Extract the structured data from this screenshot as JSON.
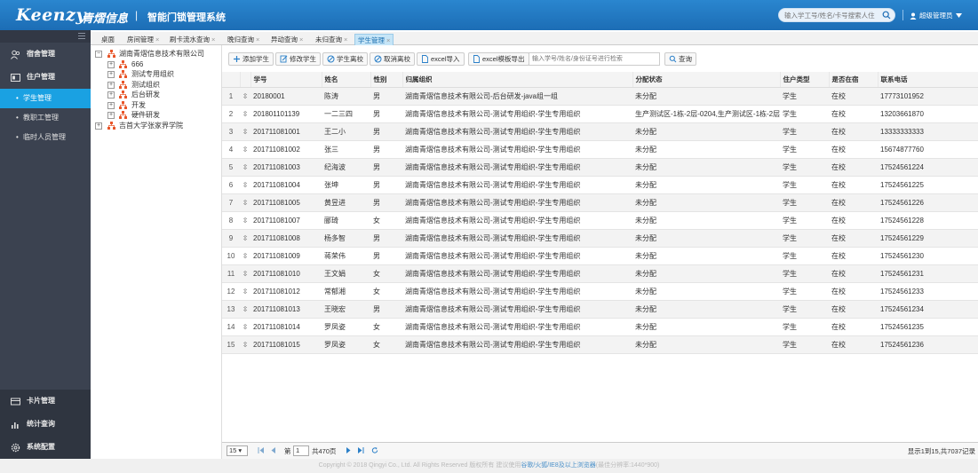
{
  "header": {
    "logo": "Keenzy",
    "logo_cn": "青熠信息",
    "separator": "|",
    "system_title": "智能门锁管理系统",
    "search_placeholder": "输入学工号/姓名/卡号搜索人住",
    "user_label": "超级管理员",
    "user_icon": "user-icon",
    "dropdown_icon": "caret-down-icon"
  },
  "sidebar": {
    "menus": [
      {
        "label": "宿舍管理",
        "icon": "dorm-icon"
      },
      {
        "label": "住户管理",
        "icon": "resident-icon"
      }
    ],
    "sub_items": [
      {
        "label": "学生管理",
        "active": true
      },
      {
        "label": "教职工管理",
        "active": false
      },
      {
        "label": "临时人员管理",
        "active": false
      }
    ],
    "bottom_menus": [
      {
        "label": "卡片管理",
        "icon": "card-icon"
      },
      {
        "label": "统计查询",
        "icon": "chart-icon"
      },
      {
        "label": "系统配置",
        "icon": "gear-icon"
      }
    ]
  },
  "tabs": [
    {
      "label": "桌面",
      "closable": false,
      "active": false
    },
    {
      "label": "房间管理",
      "closable": true,
      "active": false
    },
    {
      "label": "刷卡流水查询",
      "closable": true,
      "active": false
    },
    {
      "label": "晚归查询",
      "closable": true,
      "active": false
    },
    {
      "label": "异动查询",
      "closable": true,
      "active": false
    },
    {
      "label": "未归查询",
      "closable": true,
      "active": false
    },
    {
      "label": "学生管理",
      "closable": true,
      "active": true
    }
  ],
  "tab_close": "×",
  "tree": {
    "root": "湖南青熠信息技术有限公司",
    "children": [
      "666",
      "测试专用组织",
      "测试组织",
      "后台研发",
      "开发",
      "硬件研发"
    ],
    "other_root": "吉首大学张家界学院",
    "collapse_glyph": "−",
    "expand_glyph": "+"
  },
  "toolbar": {
    "buttons": [
      "添加学生",
      "修改学生",
      "学生离校",
      "取消离校",
      "excel导入",
      "excel模板导出"
    ],
    "search_placeholder": "输入学号/姓名/身份证号进行检索",
    "search_button": "查询"
  },
  "table": {
    "columns": [
      "学号",
      "姓名",
      "性别",
      "归属组织",
      "分配状态",
      "住户类型",
      "是否在宿",
      "联系电话"
    ],
    "expand_glyph": "⇳",
    "rows": [
      [
        "1",
        "20180001",
        "陈涛",
        "男",
        "湖南青熠信息技术有限公司-后台研发-java组一组",
        "未分配",
        "学生",
        "在校",
        "17773101952"
      ],
      [
        "2",
        "201801101139",
        "一二三四",
        "男",
        "湖南青熠信息技术有限公司-测试专用组织-学生专用组织",
        "生产测试区-1栋-2层-0204,生产测试区-1栋-2层",
        "学生",
        "在校",
        "13203661870"
      ],
      [
        "3",
        "201711081001",
        "王二小",
        "男",
        "湖南青熠信息技术有限公司-测试专用组织-学生专用组织",
        "未分配",
        "学生",
        "在校",
        "13333333333"
      ],
      [
        "4",
        "201711081002",
        "张三",
        "男",
        "湖南青熠信息技术有限公司-测试专用组织-学生专用组织",
        "未分配",
        "学生",
        "在校",
        "15674877760"
      ],
      [
        "5",
        "201711081003",
        "纪海波",
        "男",
        "湖南青熠信息技术有限公司-测试专用组织-学生专用组织",
        "未分配",
        "学生",
        "在校",
        "17524561224"
      ],
      [
        "6",
        "201711081004",
        "张坤",
        "男",
        "湖南青熠信息技术有限公司-测试专用组织-学生专用组织",
        "未分配",
        "学生",
        "在校",
        "17524561225"
      ],
      [
        "7",
        "201711081005",
        "黄昱进",
        "男",
        "湖南青熠信息技术有限公司-测试专用组织-学生专用组织",
        "未分配",
        "学生",
        "在校",
        "17524561226"
      ],
      [
        "8",
        "201711081007",
        "郦琦",
        "女",
        "湖南青熠信息技术有限公司-测试专用组织-学生专用组织",
        "未分配",
        "学生",
        "在校",
        "17524561228"
      ],
      [
        "9",
        "201711081008",
        "杨多智",
        "男",
        "湖南青熠信息技术有限公司-测试专用组织-学生专用组织",
        "未分配",
        "学生",
        "在校",
        "17524561229"
      ],
      [
        "10",
        "201711081009",
        "蒋荣伟",
        "男",
        "湖南青熠信息技术有限公司-测试专用组织-学生专用组织",
        "未分配",
        "学生",
        "在校",
        "17524561230"
      ],
      [
        "11",
        "201711081010",
        "王文娟",
        "女",
        "湖南青熠信息技术有限公司-测试专用组织-学生专用组织",
        "未分配",
        "学生",
        "在校",
        "17524561231"
      ],
      [
        "12",
        "201711081012",
        "常郁湘",
        "女",
        "湖南青熠信息技术有限公司-测试专用组织-学生专用组织",
        "未分配",
        "学生",
        "在校",
        "17524561233"
      ],
      [
        "13",
        "201711081013",
        "王晓宏",
        "男",
        "湖南青熠信息技术有限公司-测试专用组织-学生专用组织",
        "未分配",
        "学生",
        "在校",
        "17524561234"
      ],
      [
        "14",
        "201711081014",
        "罗凤姿",
        "女",
        "湖南青熠信息技术有限公司-测试专用组织-学生专用组织",
        "未分配",
        "学生",
        "在校",
        "17524561235"
      ],
      [
        "15",
        "201711081015",
        "罗凤姿",
        "女",
        "湖南青熠信息技术有限公司-测试专用组织-学生专用组织",
        "未分配",
        "学生",
        "在校",
        "17524561236"
      ]
    ]
  },
  "pager": {
    "page_size": "15",
    "page_prefix": "第",
    "current_page": "1",
    "total_pages": "共470页",
    "summary": "显示1到15,共7037记录"
  },
  "footer": {
    "copyright": "Copyright © 2018 Qingyi Co., Ltd. All Rights Reserved 版权所有 建议使用",
    "browsers": "谷歌/火狐/IE8及以上浏览器",
    "resolution": "(最佳分辨率:1440*900)"
  },
  "colors": {
    "header": "#1c6db5",
    "sidebar": "#3b4250",
    "active": "#1aa1e2",
    "org_icon": "#e8562a"
  }
}
